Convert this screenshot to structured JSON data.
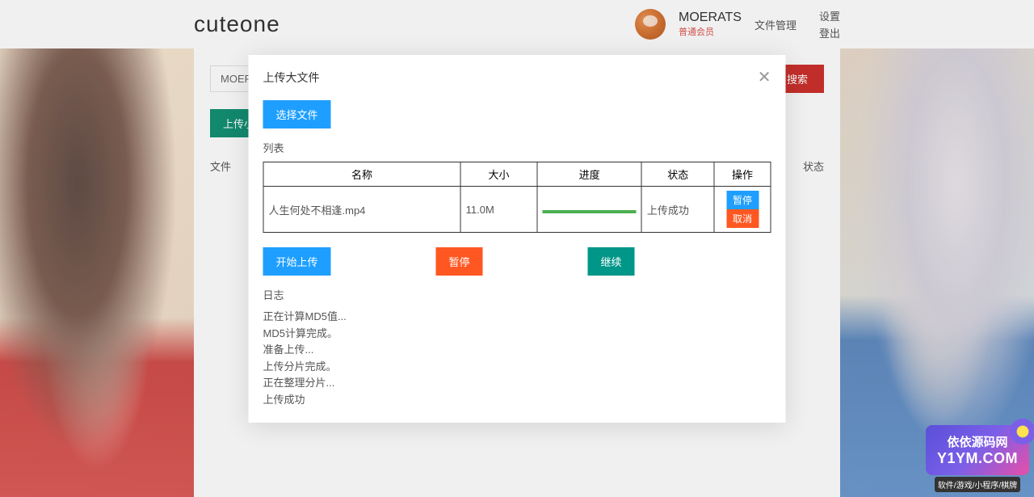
{
  "header": {
    "logo": "cuteone",
    "username": "MOERATS",
    "user_level": "普通会员",
    "links": {
      "file_manage": "文件管理",
      "settings": "设置",
      "logout": "登出"
    }
  },
  "content": {
    "breadcrumb": "MOERA",
    "search_btn": "搜索",
    "upload_small_btn": "上传小于",
    "bg_col_file": "文件",
    "bg_col_status": "状态"
  },
  "modal": {
    "title": "上传大文件",
    "select_file_btn": "选择文件",
    "list_label": "列表",
    "table": {
      "headers": {
        "name": "名称",
        "size": "大小",
        "progress": "进度",
        "status": "状态",
        "action": "操作"
      },
      "rows": [
        {
          "name": "人生何处不相逢.mp4",
          "size": "11.0M",
          "progress": 100,
          "status": "上传成功",
          "pause_btn": "暂停",
          "cancel_btn": "取消"
        }
      ]
    },
    "actions": {
      "start": "开始上传",
      "pause": "暂停",
      "continue": "继续"
    },
    "log_label": "日志",
    "logs": [
      "正在计算MD5值...",
      "MD5计算完成。",
      "准备上传...",
      "上传分片完成。",
      "正在整理分片...",
      "上传成功"
    ]
  },
  "watermark": {
    "cn": "依依源码网",
    "en": "Y1YM.COM",
    "sub": "软件/游戏/小程序/棋牌"
  }
}
